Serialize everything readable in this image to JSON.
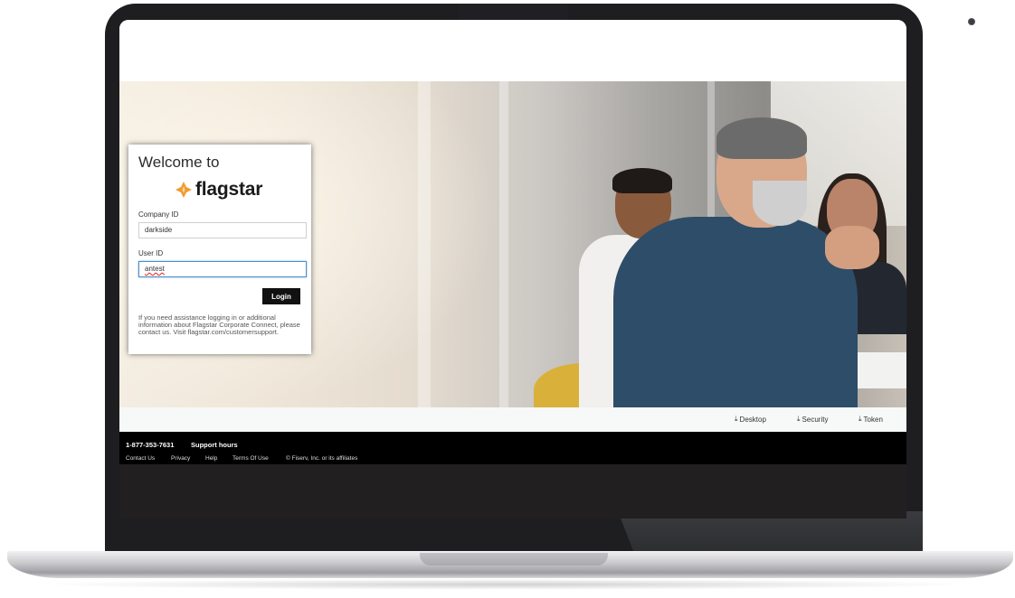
{
  "login": {
    "welcome": "Welcome to",
    "brand_name": "flagstar",
    "company_id_label": "Company ID",
    "company_id_value": "darkside",
    "user_id_label": "User ID",
    "user_id_value": "antest",
    "login_button": "Login",
    "help_text": "If you need assistance logging in or additional information about Flagstar Corporate Connect, please contact us. Visit flagstar.com/customersupport."
  },
  "downloads": [
    {
      "label": "Desktop",
      "icon": "download-icon"
    },
    {
      "label": "Security",
      "icon": "download-icon"
    },
    {
      "label": "Token",
      "icon": "download-icon"
    }
  ],
  "footer": {
    "phone": "1-877-353-7631",
    "support_hours": "Support hours",
    "links": [
      "Contact Us",
      "Privacy",
      "Help",
      "Terms Of Use"
    ],
    "copyright": "© Fiserv, Inc. or its affiliates"
  },
  "colors": {
    "brand_orange": "#f29a2e",
    "button_bg": "#111111",
    "footer_bg": "#000000",
    "focus_border": "#4e8ec4"
  }
}
